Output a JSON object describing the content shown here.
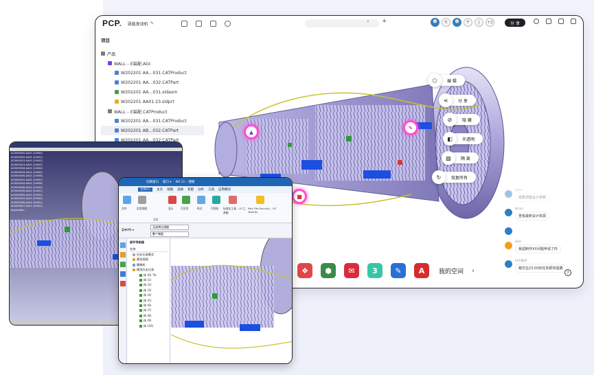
{
  "main": {
    "logo": "PCP",
    "project_name": "涡扇发动机",
    "share_label": "分 享",
    "avatar_initials": [
      "R",
      "P",
      "J",
      "+2"
    ],
    "tree": {
      "title": "项目",
      "items": [
        {
          "label": "产品",
          "indent": 0
        },
        {
          "label": "WALL – E装配.AGI",
          "indent": 1
        },
        {
          "label": "W202201 AA…031.CATProduct",
          "indent": 2
        },
        {
          "label": "W202201 AA…032.CATPart",
          "indent": 2
        },
        {
          "label": "W202201 AA…031.sldasm",
          "indent": 2
        },
        {
          "label": "W202201 AA01 23.sldprt",
          "indent": 2
        },
        {
          "label": "WALL – E装配.CATProduct",
          "indent": 1
        },
        {
          "label": "W202201 AA…031.CATProduct",
          "indent": 2
        },
        {
          "label": "W202201 AB…032.CATPart",
          "indent": 2
        },
        {
          "label": "W202201 AA…032.CATPart",
          "indent": 2
        }
      ]
    },
    "context_menu": [
      {
        "label": "编 辑",
        "icon": "cube-icon"
      },
      {
        "label": "分 享",
        "icon": "share-icon"
      },
      {
        "label": "隐 藏",
        "icon": "eye-off-icon"
      },
      {
        "label": "半透明",
        "icon": "half-square-icon"
      },
      {
        "label": "隔 离",
        "icon": "isolate-icon"
      },
      {
        "label": "恢复所有",
        "icon": "refresh-icon"
      }
    ],
    "chat": [
      {
        "name": "Ryan",
        "msg": "需要调整设计参数"
      },
      {
        "name": "Brian",
        "msg": "查看最新设计资源"
      },
      {
        "name": "",
        "msg": ""
      },
      {
        "name": "Dell",
        "msg": "我遗制作XX问题申请了你"
      },
      {
        "name": "PCP助手",
        "msg": "稿交在23:00的任务即将逾期"
      }
    ],
    "dock": {
      "space_label": "我的空间",
      "apps": [
        {
          "name": "solidworks-app",
          "color": "#e04848",
          "glyph": "❖"
        },
        {
          "name": "cube-app",
          "color": "#3d8a48",
          "glyph": "⬢"
        },
        {
          "name": "mail-app",
          "color": "#d82c3c",
          "glyph": "✉"
        },
        {
          "name": "3d-app",
          "color": "#38c7a6",
          "glyph": "3"
        },
        {
          "name": "draw-app",
          "color": "#2a6fd6",
          "glyph": "✎"
        },
        {
          "name": "autocad-app",
          "color": "#d62c2c",
          "glyph": "A"
        }
      ]
    }
  },
  "catia": {
    "tree_rows": [
      "AC0000005.AA01 (10000)",
      "AC0000010.AA01 (10001)",
      "AC0000013.AA01 (10002)",
      "AC0000014.AA01 (10003)",
      "AC0000016.AA01 (10004)",
      "AC0000019.AA01 (10005)",
      "AC0000040.AA01 (10006)",
      "AC0000041.AA01 (10007)",
      "AC0000043.AA01 (10008)",
      "AC0000048.AA01 (20000)",
      "AC0000049.AA01 (20001)",
      "AC0000050.AA01 (20002)",
      "AC0000053.AA01 (30000)",
      "AC0000056.AA01 (30001)",
      "AC0000057.AA01 (30002)",
      "Application"
    ]
  },
  "nx": {
    "title_tabs": [
      "切换窗口",
      "窗口 ▾",
      "NX 11 – 建模"
    ],
    "menu": [
      "文件(F)",
      "主页",
      "视图",
      "选择",
      "装配",
      "分析",
      "工具",
      "应用模块"
    ],
    "ribbon": [
      {
        "label": "文件"
      },
      {
        "label": "实用视图"
      },
      {
        "label": "显示"
      },
      {
        "label": "可见性"
      },
      {
        "label": "样式"
      },
      {
        "label": "可视化"
      },
      {
        "label": "标准化工具 – GC工具箱"
      },
      {
        "label": "Part File Security – GC Toolkits"
      }
    ],
    "ribbon_group": "方位",
    "filter_value": "无选择过滤器",
    "scope_value": "整个装配",
    "menu_button": "菜单(M) ▾",
    "nav_header": "部件导航器",
    "nav_col": "名称",
    "nav_rows": [
      "历史记录模式",
      "模型视图",
      "摄像机",
      "模型历史记录",
      "体 (0) \"fe",
      "体 (1)",
      "体 (2)",
      "体 (3)",
      "体 (4)",
      "体 (5)",
      "体 (6)",
      "体 (7)",
      "体 (8)",
      "体 (9)",
      "体 (10)"
    ]
  }
}
